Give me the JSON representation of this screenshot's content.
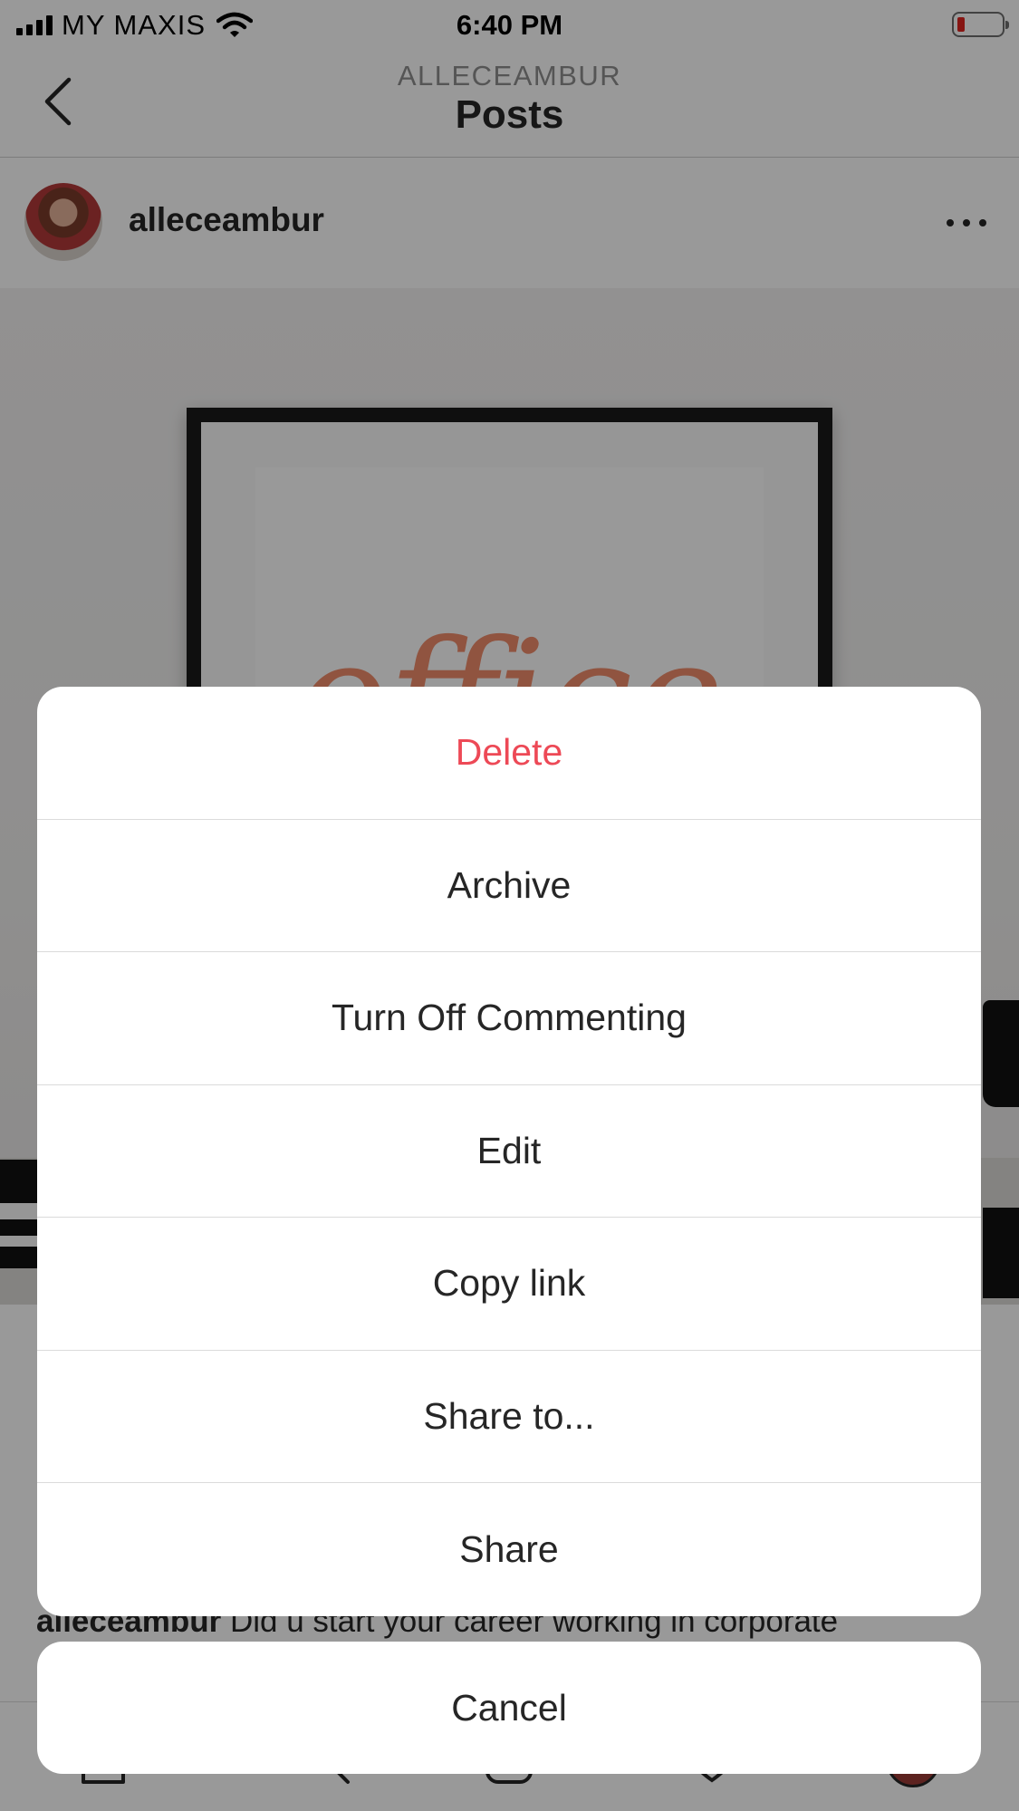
{
  "status_bar": {
    "carrier": "MY MAXIS",
    "time": "6:40 PM",
    "battery_color": "#e0231e"
  },
  "header": {
    "subtitle": "ALLECEAMBUR",
    "title": "Posts",
    "back_icon": "chevron-left-icon"
  },
  "post": {
    "username": "alleceambur",
    "more_icon": "more-horizontal-icon",
    "image_word": "office",
    "caption_username": "alleceambur",
    "caption_text": " Did u start your career working in corporate"
  },
  "action_sheet": {
    "delete_label": "Delete",
    "archive_label": "Archive",
    "turn_off_commenting_label": "Turn Off Commenting",
    "edit_label": "Edit",
    "copy_link_label": "Copy link",
    "share_to_label": "Share to...",
    "share_label": "Share",
    "cancel_label": "Cancel",
    "destructive_color": "#ed4956"
  },
  "bottom_nav": {
    "icons": [
      "home-icon",
      "search-icon",
      "add-post-icon",
      "activity-icon",
      "profile-icon"
    ]
  }
}
